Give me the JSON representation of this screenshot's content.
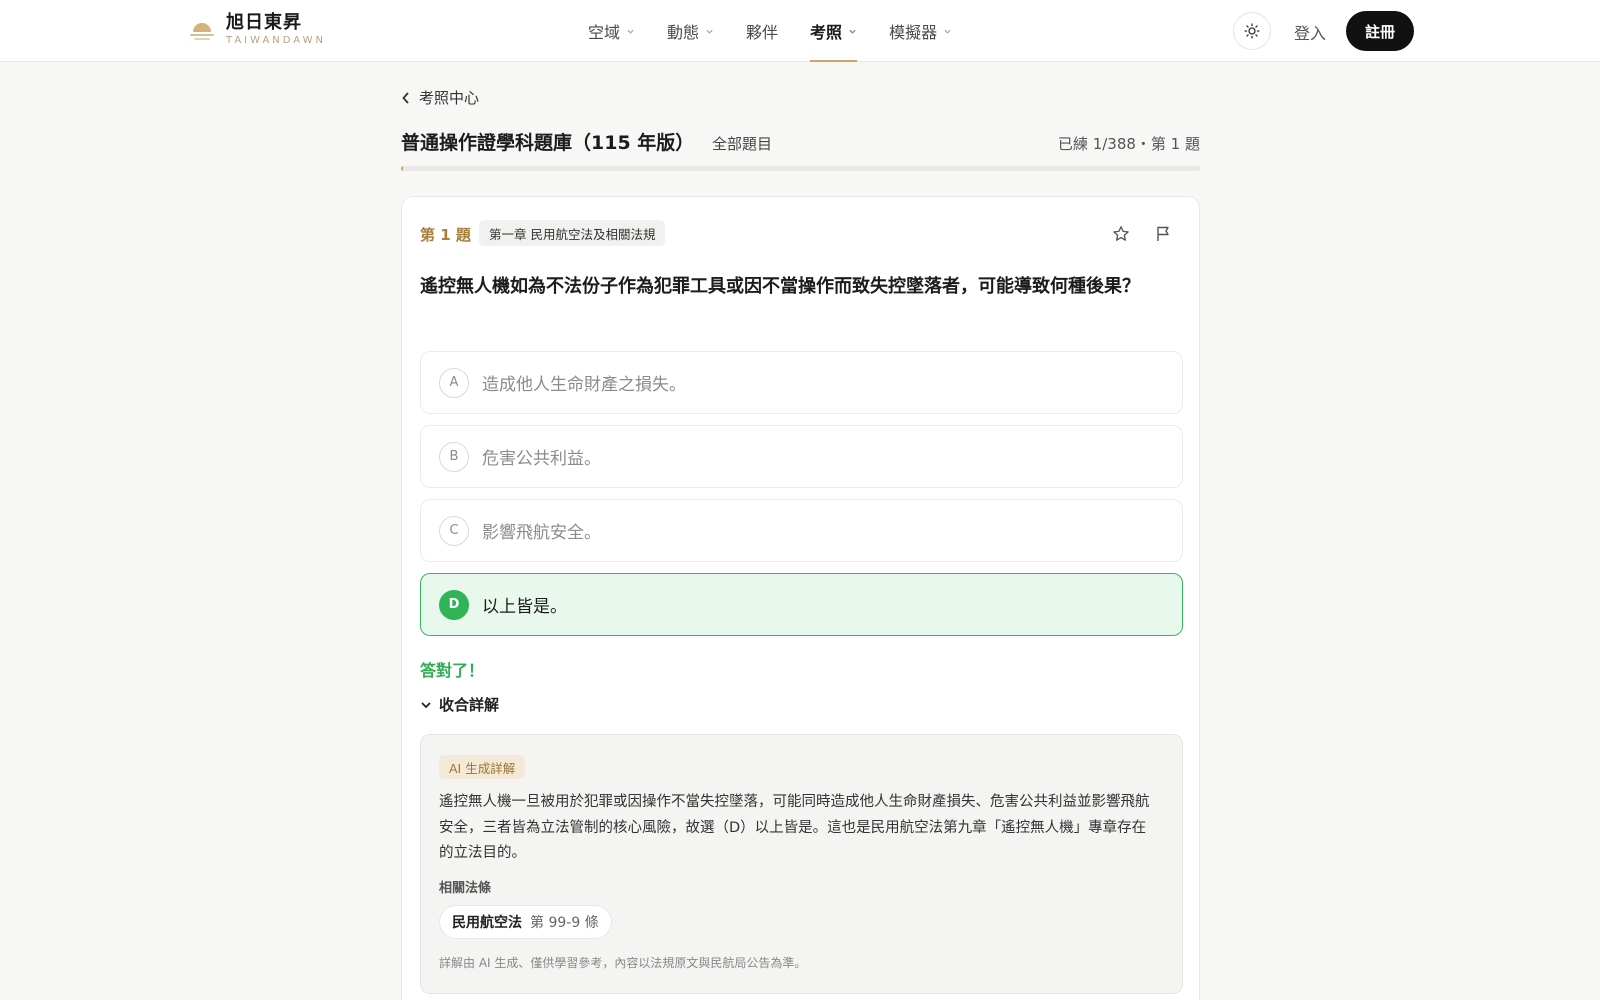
{
  "header": {
    "brand_name": "旭日東昇",
    "brand_sub": "TAIWANDAWN",
    "nav": [
      {
        "label": "空域",
        "has_menu": true
      },
      {
        "label": "動態",
        "has_menu": true
      },
      {
        "label": "夥伴",
        "has_menu": false
      },
      {
        "label": "考照",
        "has_menu": true,
        "active": true
      },
      {
        "label": "模擬器",
        "has_menu": true
      }
    ],
    "login_label": "登入",
    "register_label": "註冊"
  },
  "page": {
    "back_label": "考照中心",
    "title": "普通操作證學科題庫（115 年版）",
    "subtitle": "全部題目",
    "progress_text": "已練 1/388・第 1 題",
    "progress": {
      "done": 1,
      "total": 388
    }
  },
  "question": {
    "number_label": "第 1 題",
    "chapter": "第一章 民用航空法及相關法規",
    "text": "遙控無人機如為不法份子作為犯罪工具或因不當操作而致失控墜落者，可能導致何種後果？",
    "options": [
      {
        "letter": "A",
        "text": "造成他人生命財產之損失。"
      },
      {
        "letter": "B",
        "text": "危害公共利益。"
      },
      {
        "letter": "C",
        "text": "影響飛航安全。"
      },
      {
        "letter": "D",
        "text": "以上皆是。",
        "correct": true
      }
    ],
    "result_text": "答對了！",
    "toggle_label": "收合詳解"
  },
  "explanation": {
    "badge": "AI 生成詳解",
    "text": "遙控無人機一旦被用於犯罪或因操作不當失控墜落，可能同時造成他人生命財產損失、危害公共利益並影響飛航安全，三者皆為立法管制的核心風險，故選（D）以上皆是。這也是民用航空法第九章「遙控無人機」專章存在的立法目的。",
    "related_label": "相關法條",
    "law_name": "民用航空法",
    "law_article": "第 99-9 條",
    "disclaimer": "詳解由 AI 生成、僅供學習參考，內容以法規原文與民航局公告為準。"
  },
  "colors": {
    "accent": "#c9a56a",
    "correct": "#2fb456",
    "correct_bg": "#e9f8ec"
  }
}
